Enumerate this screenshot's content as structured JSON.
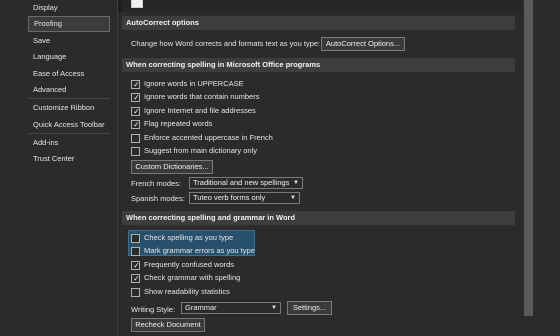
{
  "sidebar": {
    "items": [
      {
        "label": "Display",
        "active": false
      },
      {
        "label": "Proofing",
        "active": true
      },
      {
        "label": "Save",
        "active": false
      },
      {
        "label": "Language",
        "active": false
      },
      {
        "label": "Ease of Access",
        "active": false
      },
      {
        "label": "Advanced",
        "active": false
      },
      {
        "label": "Customize Ribbon",
        "active": false
      },
      {
        "label": "Quick Access Toolbar",
        "active": false
      },
      {
        "label": "Add-ins",
        "active": false
      },
      {
        "label": "Trust Center",
        "active": false
      }
    ]
  },
  "autocorrect": {
    "header": "AutoCorrect options",
    "description": "Change how Word corrects and formats text as you type:",
    "button_label": "AutoCorrect Options..."
  },
  "office": {
    "header": "When correcting spelling in Microsoft Office programs",
    "options": [
      {
        "label": "Ignore words in UPPERCASE",
        "checked": true
      },
      {
        "label": "Ignore words that contain numbers",
        "checked": true
      },
      {
        "label": "Ignore Internet and file addresses",
        "checked": true
      },
      {
        "label": "Flag repeated words",
        "checked": true
      },
      {
        "label": "Enforce accented uppercase in French",
        "checked": false
      },
      {
        "label": "Suggest from main dictionary only",
        "checked": false
      }
    ],
    "custom_dictionaries_label": "Custom Dictionaries...",
    "french_modes_label": "French modes:",
    "french_modes_value": "Traditional and new spellings",
    "spanish_modes_label": "Spanish modes:",
    "spanish_modes_value": "Tuteo verb forms only"
  },
  "word": {
    "header": "When correcting spelling and grammar in Word",
    "options": [
      {
        "label": "Check spelling as you type",
        "checked": false
      },
      {
        "label": "Mark grammar errors as you type",
        "checked": false
      },
      {
        "label": "Frequently confused words",
        "checked": true
      },
      {
        "label": "Check grammar with spelling",
        "checked": true
      },
      {
        "label": "Show readability statistics",
        "checked": false
      }
    ],
    "writing_style_label": "Writing Style:",
    "writing_style_value": "Grammar",
    "settings_label": "Settings...",
    "recheck_label": "Recheck Document"
  },
  "colors": {
    "background": "#2b2b2b",
    "section_header": "#3d3d3d",
    "highlight": "#29506b"
  }
}
